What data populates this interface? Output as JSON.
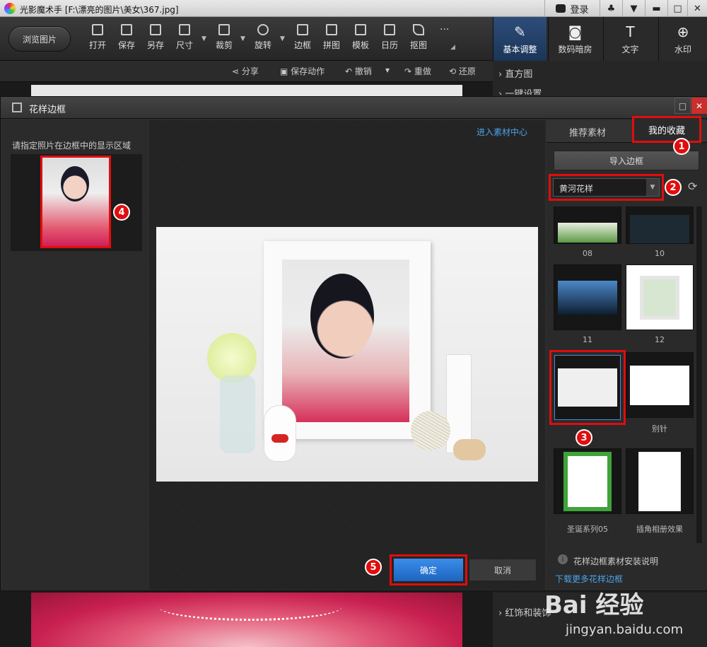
{
  "app": {
    "title": "光影魔术手 [F:\\漂亮的图片\\美女\\367.jpg]",
    "login": "登录"
  },
  "toolbar": {
    "browse": "浏览图片",
    "tools": [
      "打开",
      "保存",
      "另存",
      "尺寸",
      "裁剪",
      "旋转",
      "边框",
      "拼图",
      "模板",
      "日历",
      "抠图"
    ],
    "more": "···",
    "right_tabs": [
      "基本调整",
      "数码暗房",
      "文字",
      "水印"
    ]
  },
  "secondary": {
    "share": "分享",
    "save_action": "保存动作",
    "undo": "撤销",
    "redo": "重做",
    "restore": "还原"
  },
  "right_panel": {
    "histogram": "直方图",
    "oneclick": "一键设置",
    "redfix": "红饰和装饰"
  },
  "dialog": {
    "title": "花样边框",
    "instruction": "请指定照片在边框中的显示区域",
    "enter_center": "进入素材中心",
    "tabs": [
      "推荐素材",
      "我的收藏"
    ],
    "import": "导入边框",
    "category": "黄河花样",
    "thumbs": [
      "08",
      "10",
      "11",
      "12",
      "",
      "别针",
      "圣诞系列05",
      "插角相册效果"
    ],
    "install_note": "花样边框素材安装说明",
    "download_more": "下载更多花样边框",
    "ok": "确定",
    "cancel": "取消"
  },
  "badges": [
    "1",
    "2",
    "3",
    "4",
    "5"
  ],
  "watermark": {
    "brand": "Bai 经验",
    "url": "jingyan.baidu.com"
  }
}
